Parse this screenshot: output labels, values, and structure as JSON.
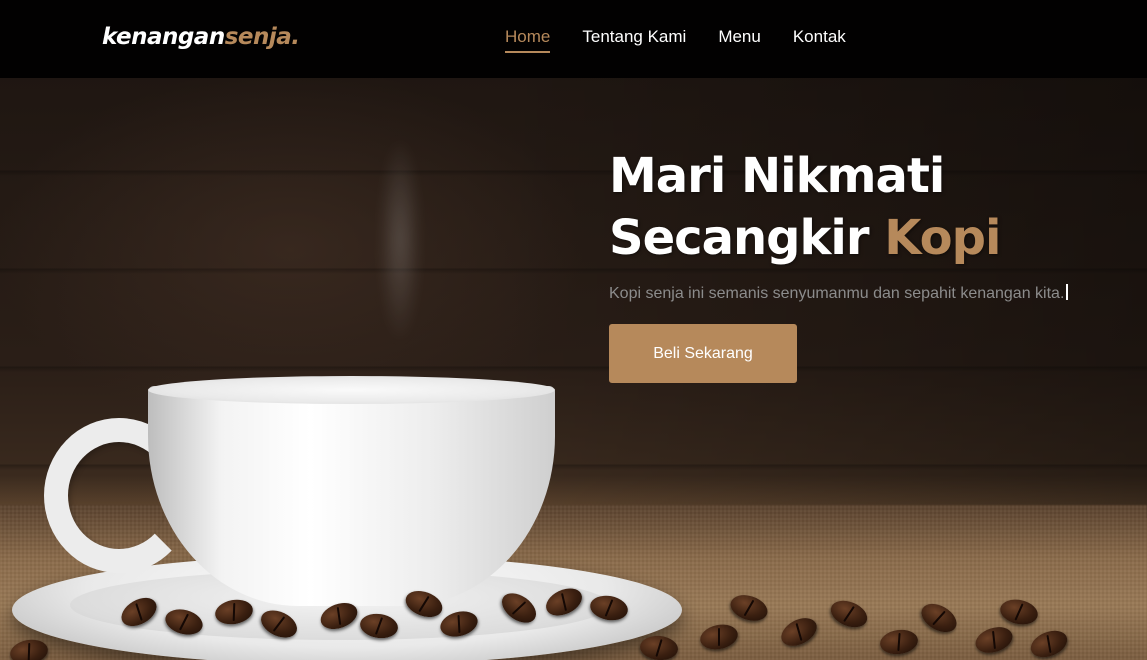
{
  "brand": {
    "logo_main": "kenangan",
    "logo_accent": "senja.",
    "accent_color": "#b6895b"
  },
  "nav": {
    "items": [
      {
        "label": "Home",
        "active": true
      },
      {
        "label": "Tentang Kami",
        "active": false
      },
      {
        "label": "Menu",
        "active": false
      },
      {
        "label": "Kontak",
        "active": false
      }
    ]
  },
  "hero": {
    "title_line1": "Mari Nikmati",
    "title_line2_main": "Secangkir ",
    "title_line2_accent": "Kopi",
    "subtitle": "Kopi senja ini semanis senyumanmu dan sepahit kenangan kita.",
    "cta_label": "Beli Sekarang",
    "background_image": "coffee-cup-with-beans"
  }
}
